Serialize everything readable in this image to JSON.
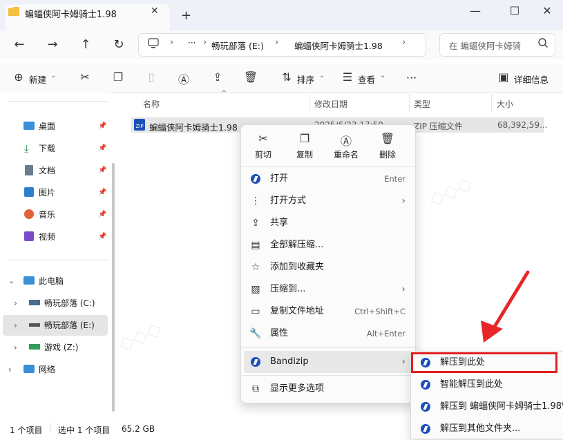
{
  "window": {
    "tab_title": "蝙蝠侠阿卡姆骑士1.98",
    "tab_close": "✕",
    "new_tab": "+",
    "minimize": "—",
    "maximize": "☐",
    "close": "✕"
  },
  "nav": {
    "back": "←",
    "forward": "→",
    "up": "↑",
    "refresh": "↻",
    "breadcrumb": [
      "畅玩部落 (E:)",
      "蝙蝠侠阿卡姆骑士1.98"
    ],
    "ellipsis": "···",
    "search_placeholder": "在 蝙蝠侠阿卡姆骑"
  },
  "toolbar": {
    "new_label": "新建",
    "sort_label": "排序",
    "view_label": "查看",
    "more": "···",
    "details_label": "详细信息"
  },
  "sidebar": {
    "quick": [
      {
        "label": "桌面",
        "icon": "desktop-icon"
      },
      {
        "label": "下载",
        "icon": "download-icon"
      },
      {
        "label": "文档",
        "icon": "document-icon"
      },
      {
        "label": "图片",
        "icon": "picture-icon"
      },
      {
        "label": "音乐",
        "icon": "music-icon"
      },
      {
        "label": "视频",
        "icon": "video-icon"
      }
    ],
    "this_pc": "此电脑",
    "drives": [
      "畅玩部落 (C:)",
      "畅玩部落 (E:)",
      "游戏 (Z:)"
    ],
    "network": "网络"
  },
  "columns": {
    "name": "名称",
    "date": "修改日期",
    "type": "类型",
    "size": "大小"
  },
  "file": {
    "name": "蝙蝠侠阿卡姆骑士1.98",
    "date": "2025/6/23 17:50",
    "type": "ZIP 压缩文件",
    "size": "68,392,59..."
  },
  "status": {
    "count": "1 个项目",
    "selected": "选中 1 个项目",
    "size": "65.2 GB"
  },
  "context_menu": {
    "quick": [
      "剪切",
      "复制",
      "重命名",
      "删除"
    ],
    "items": [
      {
        "label": "打开",
        "shortcut": "Enter"
      },
      {
        "label": "打开方式",
        "shortcut": ""
      },
      {
        "label": "共享",
        "shortcut": ""
      },
      {
        "label": "全部解压缩...",
        "shortcut": ""
      },
      {
        "label": "添加到收藏夹",
        "shortcut": ""
      },
      {
        "label": "压缩到...",
        "shortcut": ""
      },
      {
        "label": "复制文件地址",
        "shortcut": "Ctrl+Shift+C"
      },
      {
        "label": "属性",
        "shortcut": "Alt+Enter"
      }
    ],
    "bandizip": "Bandizip",
    "more_options": "显示更多选项"
  },
  "submenu": {
    "items": [
      "解压到此处",
      "智能解压到此处",
      "解压到 蝙蝠侠阿卡姆骑士1.98\\",
      "解压到其他文件夹..."
    ]
  },
  "colors": {
    "highlight": "#e02020",
    "arrow": "#e8262a",
    "bandizip": "#1d4fb8",
    "folder": "#f4c13d"
  }
}
